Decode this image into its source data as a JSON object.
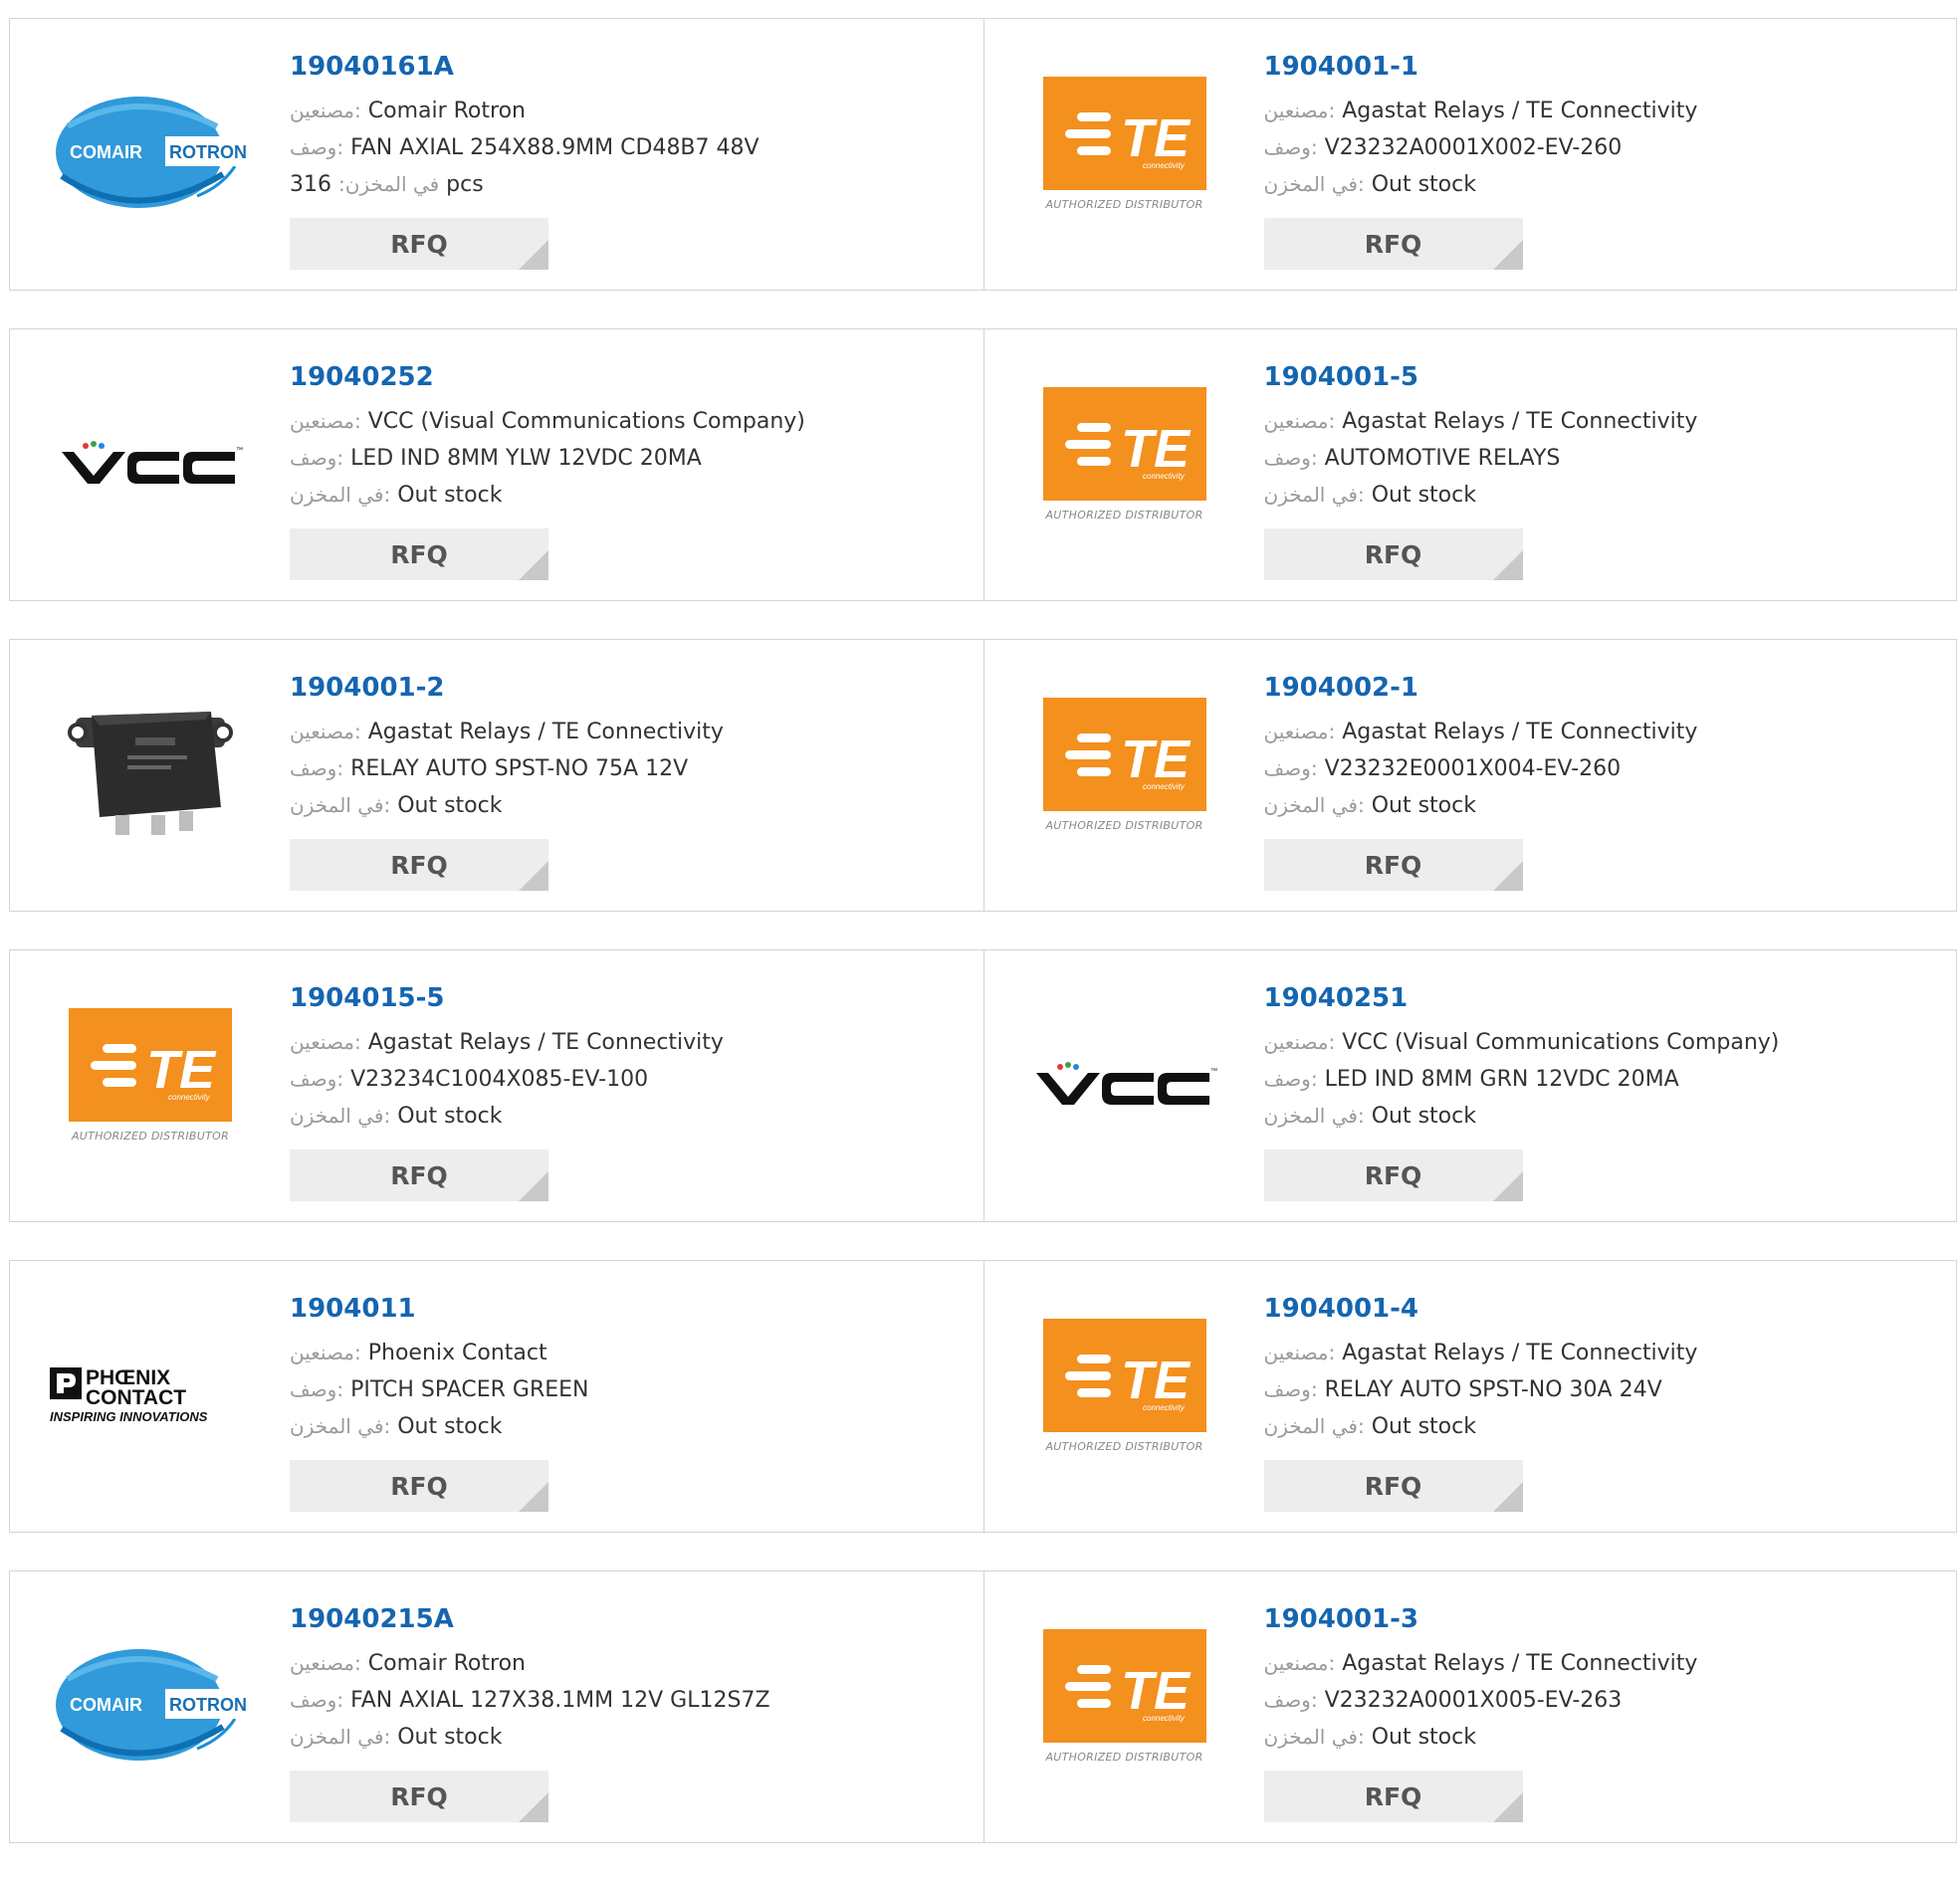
{
  "labels": {
    "manufacturer": "مصنعين:",
    "description": "وصف:",
    "stock": "في المخزن:",
    "rfq": "RFQ"
  },
  "brands": {
    "te_authorized": "AUTHORIZED DISTRIBUTOR",
    "te_connectivity": "connectivity",
    "te_letters": "TE",
    "comair_left": "COMAIR",
    "comair_right": "ROTRON",
    "vcc": "VCC",
    "vcc_tm": "™",
    "phoenix_line1": "PHŒNIX",
    "phoenix_line2": "CONTACT",
    "phoenix_tagline": "INSPIRING INNOVATIONS"
  },
  "colors": {
    "part_link": "#1565b0",
    "te_orange": "#f3901e",
    "comair_blue": "#1a8fd6"
  },
  "products": [
    {
      "part": "19040161A",
      "logo": "comair",
      "manufacturer": "Comair Rotron",
      "description": "FAN AXIAL 254X88.9MM CD48B7 48V",
      "stock_value": "316",
      "stock_unit": "pcs"
    },
    {
      "part": "1904001-1",
      "logo": "te",
      "manufacturer": "Agastat Relays / TE Connectivity",
      "description": "V23232A0001X002-EV-260",
      "stock_value": "Out stock",
      "stock_unit": ""
    },
    {
      "part": "19040252",
      "logo": "vcc",
      "manufacturer": "VCC (Visual Communications Company)",
      "description": "LED IND 8MM YLW 12VDC 20MA",
      "stock_value": "Out stock",
      "stock_unit": ""
    },
    {
      "part": "1904001-5",
      "logo": "te",
      "manufacturer": "Agastat Relays / TE Connectivity",
      "description": "AUTOMOTIVE RELAYS",
      "stock_value": "Out stock",
      "stock_unit": ""
    },
    {
      "part": "1904001-2",
      "logo": "relay",
      "manufacturer": "Agastat Relays / TE Connectivity",
      "description": "RELAY AUTO SPST-NO 75A 12V",
      "stock_value": "Out stock",
      "stock_unit": ""
    },
    {
      "part": "1904002-1",
      "logo": "te",
      "manufacturer": "Agastat Relays / TE Connectivity",
      "description": "V23232E0001X004-EV-260",
      "stock_value": "Out stock",
      "stock_unit": ""
    },
    {
      "part": "1904015-5",
      "logo": "te",
      "manufacturer": "Agastat Relays / TE Connectivity",
      "description": "V23234C1004X085-EV-100",
      "stock_value": "Out stock",
      "stock_unit": ""
    },
    {
      "part": "19040251",
      "logo": "vcc",
      "manufacturer": "VCC (Visual Communications Company)",
      "description": "LED IND 8MM GRN 12VDC 20MA",
      "stock_value": "Out stock",
      "stock_unit": ""
    },
    {
      "part": "1904011",
      "logo": "phoenix",
      "manufacturer": "Phoenix Contact",
      "description": "PITCH SPACER GREEN",
      "stock_value": "Out stock",
      "stock_unit": ""
    },
    {
      "part": "1904001-4",
      "logo": "te",
      "manufacturer": "Agastat Relays / TE Connectivity",
      "description": "RELAY AUTO SPST-NO 30A 24V",
      "stock_value": "Out stock",
      "stock_unit": ""
    },
    {
      "part": "19040215A",
      "logo": "comair",
      "manufacturer": "Comair Rotron",
      "description": "FAN AXIAL 127X38.1MM 12V GL12S7Z",
      "stock_value": "Out stock",
      "stock_unit": ""
    },
    {
      "part": "1904001-3",
      "logo": "te",
      "manufacturer": "Agastat Relays / TE Connectivity",
      "description": "V23232A0001X005-EV-263",
      "stock_value": "Out stock",
      "stock_unit": ""
    }
  ]
}
